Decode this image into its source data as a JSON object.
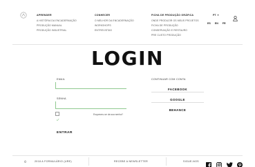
{
  "header": {
    "logo_icon": "brand-logo-icon",
    "columns": [
      {
        "title": "APRENDER",
        "items": [
          "A HISTÓRIA DA ENCADERNAÇÃO",
          "PRODUÇÃO MANUAL",
          "PRODUÇÃO INDUSTRIAL"
        ]
      },
      {
        "title": "CONHECER",
        "items": [
          "O MELHOR DA ENCADERNAÇÃO",
          "WORKSHOPS",
          "ENTREVISTAS"
        ]
      },
      {
        "title": "FICHA DE PRODUÇÃO GRÁFICA",
        "items": [
          "ONDE PRODUZIR OS MEUS PROJETOS",
          "FICHA DE PRODUÇÃO",
          "CONSERVAÇÃO E RESTAURO",
          "PRE CUSTO PRODUÇÃO"
        ]
      }
    ],
    "language_current": "PT",
    "language_caret": "▾",
    "languages": [
      "ES",
      "EN",
      "FR"
    ],
    "user_icon": "user-icon"
  },
  "login": {
    "title": "LOGIN",
    "email_label": "EMAIL",
    "email_value": "",
    "password_label": "SENHA",
    "password_value": "",
    "forgot_label": "Esqueceu-se da sua senha?",
    "submit_label": "ENTRAR",
    "social_heading": "CONTINUAR COM CONTA",
    "social_buttons": [
      "FACEBOOK",
      "GOOGLE",
      "BEHANCE"
    ]
  },
  "footer": {
    "copyright_symbol": "©",
    "copyright_text": "2018 A FORMULÁRIO (URE)",
    "newsletter_label": "RECEBE A NEWSLETTER",
    "follow_label": "SIGUE-NOS",
    "social_icons": [
      "facebook-icon",
      "instagram-icon",
      "twitter-icon",
      "pinterest-icon"
    ]
  },
  "colors": {
    "accent_green": "#8fc98f",
    "line": "#cccccc",
    "text_dark": "#111111"
  }
}
